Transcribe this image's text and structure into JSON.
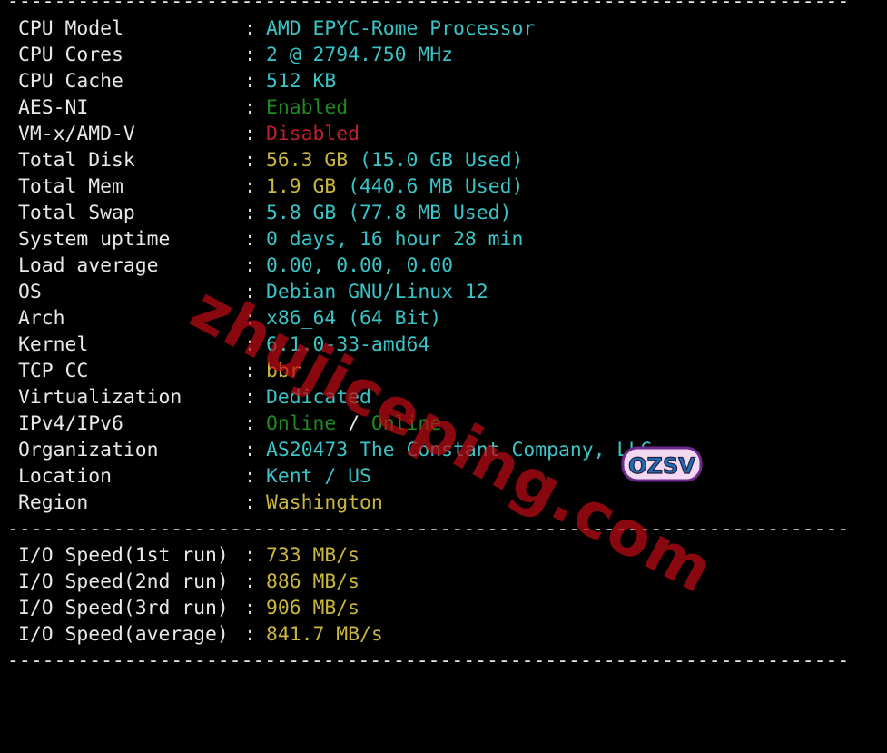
{
  "separator": "------------------------------------------------------------------------",
  "info_rows": [
    {
      "label": "CPU Model",
      "colon": ":",
      "value": "AMD EPYC-Rome Processor"
    },
    {
      "label": "CPU Cores",
      "colon": ":",
      "value": "2 @ 2794.750 MHz"
    },
    {
      "label": "CPU Cache",
      "colon": ":",
      "value": "512 KB"
    },
    {
      "label": "AES-NI",
      "colon": ":",
      "value": "Enabled"
    },
    {
      "label": "VM-x/AMD-V",
      "colon": ":",
      "value": "Disabled"
    },
    {
      "label": "Total Disk",
      "colon": ":",
      "value": "56.3 GB (15.0 GB Used)"
    },
    {
      "label": "Total Mem",
      "colon": ":",
      "value": "1.9 GB (440.6 MB Used)"
    },
    {
      "label": "Total Swap",
      "colon": ":",
      "value": "5.8 GB (77.8 MB Used)"
    },
    {
      "label": "System uptime",
      "colon": ":",
      "value": "0 days, 16 hour 28 min"
    },
    {
      "label": "Load average",
      "colon": ":",
      "value": "0.00, 0.00, 0.00"
    },
    {
      "label": "OS",
      "colon": ":",
      "value": "Debian GNU/Linux 12"
    },
    {
      "label": "Arch",
      "colon": ":",
      "value": "x86_64 (64 Bit)"
    },
    {
      "label": "Kernel",
      "colon": ":",
      "value": "6.1.0-33-amd64"
    },
    {
      "label": "TCP CC",
      "colon": ":",
      "value": "bbr"
    },
    {
      "label": "Virtualization",
      "colon": ":",
      "value": "Dedicated"
    },
    {
      "label": "IPv4/IPv6",
      "colon": ":",
      "value_ipv4": "Online",
      "slash": " / ",
      "value_ipv6": "Online"
    },
    {
      "label": "Organization",
      "colon": ":",
      "value": "AS20473 The Constant Company, LLC"
    },
    {
      "label": "Location",
      "colon": ":",
      "value": "Kent / US"
    },
    {
      "label": "Region",
      "colon": ":",
      "value": "Washington"
    }
  ],
  "io_rows": [
    {
      "label": "I/O Speed(1st run)",
      "colon": ":",
      "value": "733 MB/s"
    },
    {
      "label": "I/O Speed(2nd run)",
      "colon": ":",
      "value": "886 MB/s"
    },
    {
      "label": "I/O Speed(3rd run)",
      "colon": ":",
      "value": "906 MB/s"
    },
    {
      "label": "I/O Speed(average)",
      "colon": ":",
      "value": "841.7 MB/s"
    }
  ],
  "watermark": {
    "text": "zhujiceping.com"
  },
  "logo": {
    "text": "OZSV"
  },
  "colors": {
    "background": "#000000",
    "label": "#e8e8e8",
    "cyan_value": "#3ac4c7",
    "yellow_value": "#c9b63d",
    "green_value": "#1f8a1f",
    "red_value": "#c0202b",
    "watermark": "#be0a14"
  }
}
